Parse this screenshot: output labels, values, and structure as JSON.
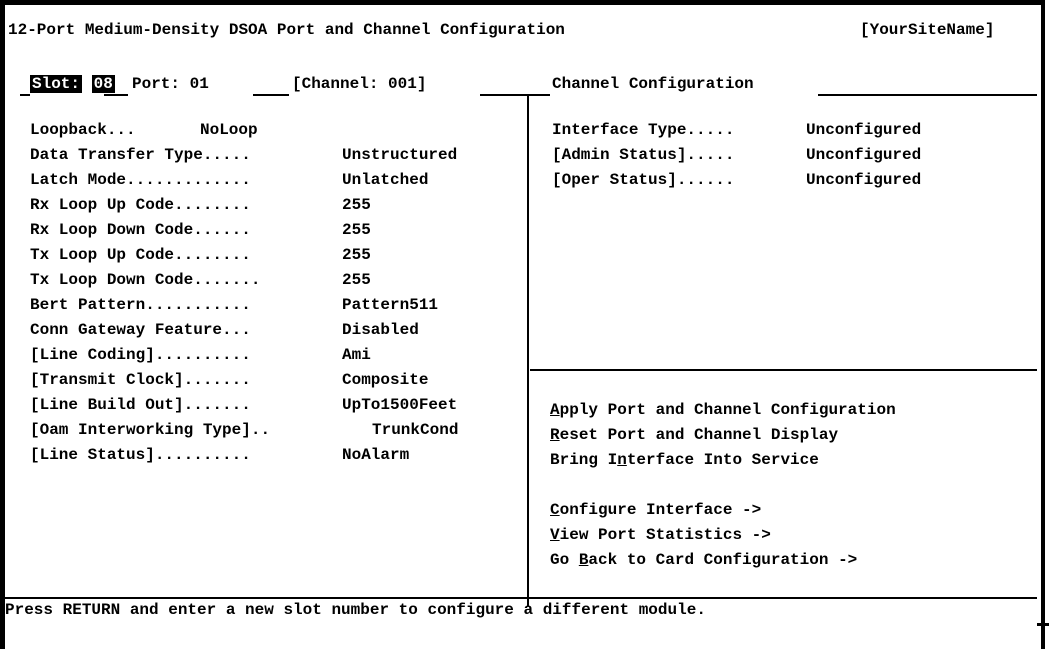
{
  "header": {
    "title": "12-Port Medium-Density DSOA Port and Channel Configuration",
    "site": "[YourSiteName]"
  },
  "context": {
    "slot_label": "Slot:",
    "slot_value": "08",
    "port": "Port: 01",
    "channel": "[Channel: 001]",
    "section": "Channel Configuration"
  },
  "port_settings": [
    {
      "label": "Loopback...",
      "value": "NoLoop"
    },
    {
      "label": "Data Transfer Type.....",
      "value": "Unstructured"
    },
    {
      "label": "Latch Mode.............",
      "value": "Unlatched"
    },
    {
      "label": "Rx Loop Up Code........",
      "value": "255"
    },
    {
      "label": "Rx Loop Down Code......",
      "value": "255"
    },
    {
      "label": "Tx Loop Up Code........",
      "value": "255"
    },
    {
      "label": "Tx Loop Down Code.......",
      "value": "255"
    },
    {
      "label": "Bert Pattern...........",
      "value": "Pattern511"
    },
    {
      "label": "Conn Gateway Feature...",
      "value": "Disabled"
    },
    {
      "label": "[Line Coding]..........",
      "value": "Ami"
    },
    {
      "label": "[Transmit Clock].......",
      "value": "Composite"
    },
    {
      "label": "[Line Build Out].......",
      "value": "UpTo1500Feet"
    },
    {
      "label": "[Oam Interworking Type]..",
      "value": "TrunkCond"
    },
    {
      "label": "[Line Status]..........",
      "value": "NoAlarm"
    }
  ],
  "channel_settings": [
    {
      "label": "Interface Type.....",
      "value": "Unconfigured"
    },
    {
      "label": "[Admin Status].....",
      "value": "Unconfigured"
    },
    {
      "label": "[Oper Status]......",
      "value": "Unconfigured"
    }
  ],
  "actions": [
    {
      "pre": "",
      "key": "A",
      "post": "pply Port and Channel Configuration"
    },
    {
      "pre": "",
      "key": "R",
      "post": "eset Port and Channel Display"
    },
    {
      "pre": "Bring I",
      "key": "n",
      "post": "terface Into Service"
    }
  ],
  "navigation": [
    {
      "pre": "",
      "key": "C",
      "post": "onfigure Interface ->"
    },
    {
      "pre": "",
      "key": "V",
      "post": "iew Port Statistics ->"
    },
    {
      "pre": "Go ",
      "key": "B",
      "post": "ack to Card Configuration ->"
    }
  ],
  "status_message": "Press RETURN and enter a new slot number to configure a different module."
}
